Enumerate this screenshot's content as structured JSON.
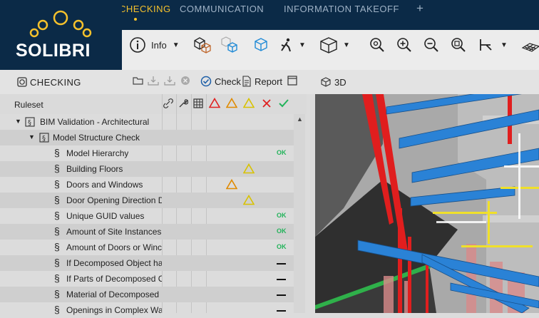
{
  "app": {
    "logo_text": "SOLIBRI",
    "tabs": [
      {
        "label": "CHECKING",
        "active": true
      },
      {
        "label": "COMMUNICATION",
        "active": false
      },
      {
        "label": "INFORMATION TAKEOFF",
        "active": false
      }
    ],
    "add_tab_label": "+"
  },
  "toolbar": {
    "info_label": "Info"
  },
  "checking_panel": {
    "title": "CHECKING",
    "check_label": "Check",
    "report_label": "Report"
  },
  "view_panel": {
    "title": "3D"
  },
  "ruleset": {
    "header": "Ruleset",
    "rows": [
      {
        "name": "BIM Validation - Architectural",
        "level": 0,
        "status": ""
      },
      {
        "name": "Model Structure Check",
        "level": 1,
        "status": ""
      },
      {
        "name": "Model Hierarchy",
        "level": 2,
        "status": "OK"
      },
      {
        "name": "Building Floors",
        "level": 2,
        "status": "warning-low"
      },
      {
        "name": "Doors and Windows",
        "level": 2,
        "status": "warning-medium"
      },
      {
        "name": "Door Opening Direction D",
        "level": 2,
        "status": "warning-low"
      },
      {
        "name": "Unique GUID values",
        "level": 2,
        "status": "OK"
      },
      {
        "name": "Amount of Site Instances",
        "level": 2,
        "status": "OK"
      },
      {
        "name": "Amount of Doors or Winc",
        "level": 2,
        "status": "OK"
      },
      {
        "name": "If Decomposed Object ha",
        "level": 2,
        "status": "not-checked"
      },
      {
        "name": "If Parts of Decomposed C",
        "level": 2,
        "status": "not-checked"
      },
      {
        "name": "Material of Decomposed",
        "level": 2,
        "status": "not-checked"
      },
      {
        "name": "Openings in Complex Wa",
        "level": 2,
        "status": "not-checked"
      }
    ]
  },
  "colors": {
    "brand_navy": "#0b2a47",
    "active_tab": "#f5c12c",
    "severity_high": "#e02020",
    "severity_medium": "#e08a00",
    "severity_low": "#d8c200",
    "passed": "#22b35a"
  }
}
